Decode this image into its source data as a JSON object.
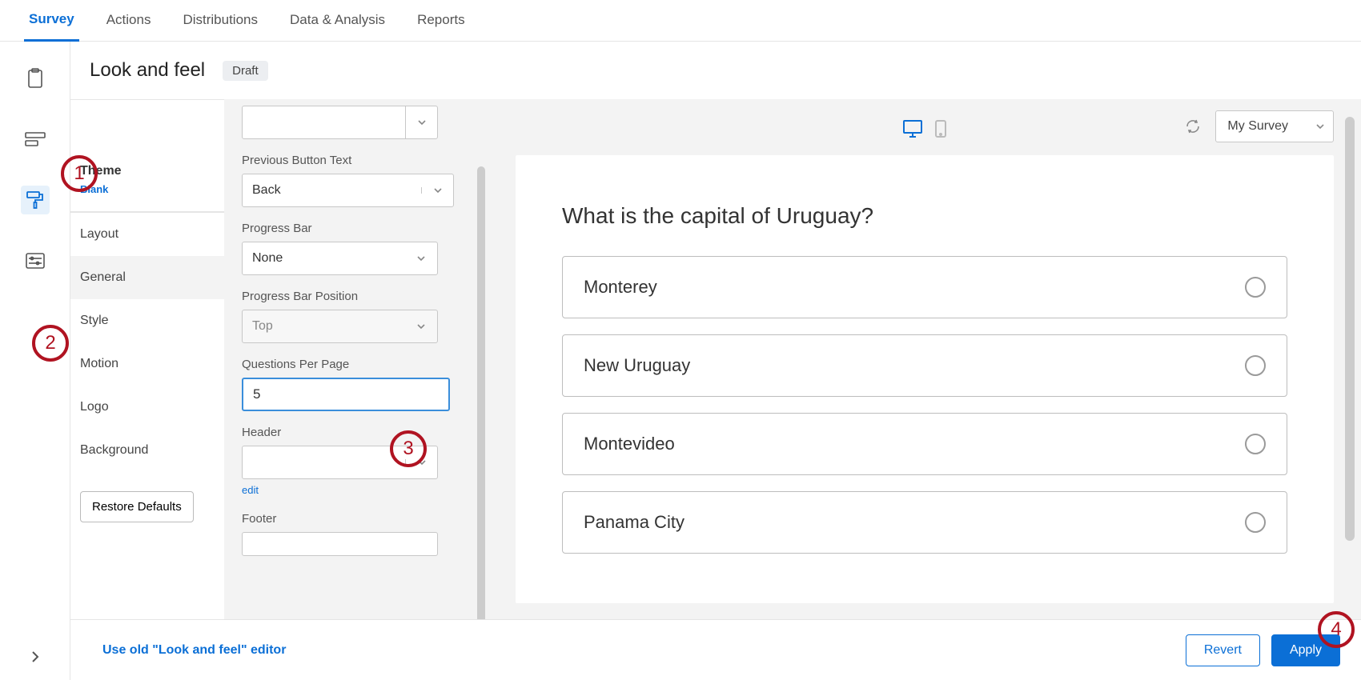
{
  "tabs": [
    "Survey",
    "Actions",
    "Distributions",
    "Data & Analysis",
    "Reports"
  ],
  "page": {
    "title": "Look and feel",
    "badge": "Draft"
  },
  "theme": {
    "label": "Theme",
    "name": "Blank"
  },
  "nav": {
    "layout": "Layout",
    "general": "General",
    "style": "Style",
    "motion": "Motion",
    "logo": "Logo",
    "background": "Background"
  },
  "restore": "Restore Defaults",
  "settings": {
    "prevBtn": {
      "label": "Previous Button Text",
      "value": "Back"
    },
    "progressBar": {
      "label": "Progress Bar",
      "value": "None"
    },
    "progressBarPos": {
      "label": "Progress Bar Position",
      "value": "Top"
    },
    "qpp": {
      "label": "Questions Per Page",
      "value": "5"
    },
    "header": {
      "label": "Header",
      "value": "",
      "edit": "edit"
    },
    "footer": {
      "label": "Footer",
      "value": ""
    }
  },
  "preview": {
    "surveyName": "My Survey",
    "question": "What is the capital of Uruguay?",
    "choices": [
      "Monterey",
      "New Uruguay",
      "Montevideo",
      "Panama City"
    ]
  },
  "footer": {
    "oldLink": "Use old \"Look and feel\" editor",
    "revert": "Revert",
    "apply": "Apply"
  },
  "callouts": {
    "c1": "1",
    "c2": "2",
    "c3": "3",
    "c4": "4"
  }
}
